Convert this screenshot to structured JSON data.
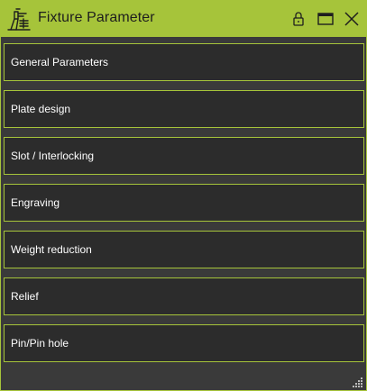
{
  "window": {
    "title": "Fixture Parameter",
    "accent_color": "#a6c43a",
    "background_color": "#3a3a3a",
    "panel_color": "#2c2c2c",
    "icons": {
      "app": "fixture-icon",
      "lock": "lock-icon",
      "maximize": "maximize-icon",
      "close": "close-icon",
      "resize": "resize-grip-icon"
    }
  },
  "sections": [
    {
      "label": "General Parameters"
    },
    {
      "label": "Plate design"
    },
    {
      "label": "Slot / Interlocking"
    },
    {
      "label": "Engraving"
    },
    {
      "label": "Weight reduction"
    },
    {
      "label": "Relief"
    },
    {
      "label": "Pin/Pin hole"
    }
  ]
}
